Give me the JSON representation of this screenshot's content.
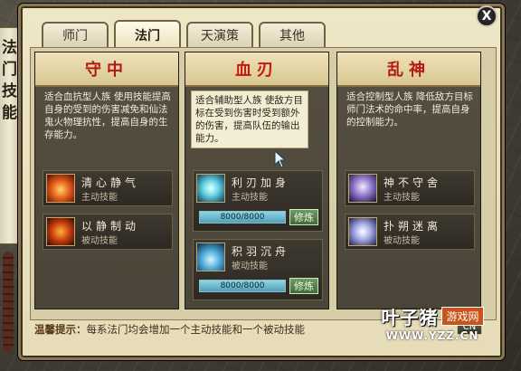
{
  "side_banner": [
    "法",
    "门",
    "技",
    "能"
  ],
  "close_label": "X",
  "tabs": [
    {
      "label": "师门",
      "active": false
    },
    {
      "label": "法门",
      "active": true
    },
    {
      "label": "天演策",
      "active": false
    },
    {
      "label": "其他",
      "active": false
    }
  ],
  "columns": [
    {
      "title": "守中",
      "desc": "适合血抗型人族\n使用技能提高自身的受到的伤害减免和仙法鬼火物理抗性，提高自身的生存能力。",
      "skills": [
        {
          "name": "清心静气",
          "type": "主动技能",
          "icon": "fire-skill-icon"
        },
        {
          "name": "以静制动",
          "type": "被动技能",
          "icon": "fire-skill-icon"
        }
      ]
    },
    {
      "title": "血刃",
      "desc": "适合辅助型人族\n使敌方目标在受到伤害时受到额外的伤害，提高队伍的输出能力。",
      "skills": [
        {
          "name": "利刃加身",
          "type": "主动技能",
          "icon": "ice-skill-icon",
          "progress": "8000/8000",
          "train": "修炼",
          "progress_value": 1.0
        },
        {
          "name": "积羽沉舟",
          "type": "被动技能",
          "icon": "ice-skill-icon",
          "progress": "8000/8000",
          "train": "修炼",
          "progress_value": 1.0
        }
      ]
    },
    {
      "title": "乱神",
      "desc": "适合控制型人族\n降低敌方目标师门法术的命中率，提高自身的控制能力。",
      "skills": [
        {
          "name": "神不守舍",
          "type": "主动技能",
          "icon": "purple-skill-icon"
        },
        {
          "name": "扑朔迷离",
          "type": "被动技能",
          "icon": "purple-skill-icon"
        }
      ]
    }
  ],
  "tip_label": "温馨提示：",
  "tip_text": "每系法门均会增加一个主动技能和一个被动技能",
  "watermark": {
    "logo": "叶子猪",
    "badge": "游戏网",
    "url": "WWW.YZZ.CN"
  },
  "ok_label": "CN"
}
